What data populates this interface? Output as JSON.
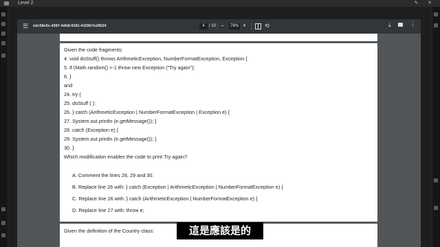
{
  "window": {
    "title": "Level 2"
  },
  "toolbar": {
    "doc_title": "edc58e5c-4387-4db8-9181-4159b7ed9624",
    "page_current": "4",
    "page_total": "/ 10",
    "zoom_out": "−",
    "zoom": "78%",
    "zoom_in": "+",
    "menu_icon": "☰",
    "rotate_icon": "⟲",
    "download_icon": "⤓",
    "more_icon": "⋮"
  },
  "question": {
    "lines": [
      "Given the code fragments:",
      "4. void doStuff() throws ArithmeticException, NumberFormatException, Exception {",
      "5. if (Math.random() >-1 throw new Exception (\"Try again\");",
      "6. }",
      "and",
      "24. try {",
      "25. doStuff ( ):",
      "26. } catch (ArithmeticException | NumberFormatException | Exception e) {",
      "27. System.out.println (e.getMessage()); }",
      "28. catch (Exception e) {",
      "29. System.out.println (e.getMessage()); }",
      "30. }",
      "Which modification enables the code to print Try again?"
    ],
    "options": [
      "A.  Comment the lines 28, 29 and 30.",
      "B.  Replace line 26 with: } catch (Exception | ArithmeticException | NumberFormatException e) {",
      "C.  Replace line 26 with: } catch (ArithmeticException | NumberFormatException e) {",
      "D.  Replace line 27 with: throw e;"
    ]
  },
  "next_page": {
    "text": "Given the definition of the Country class:"
  },
  "subtitle": {
    "text": "這是應該是的"
  }
}
